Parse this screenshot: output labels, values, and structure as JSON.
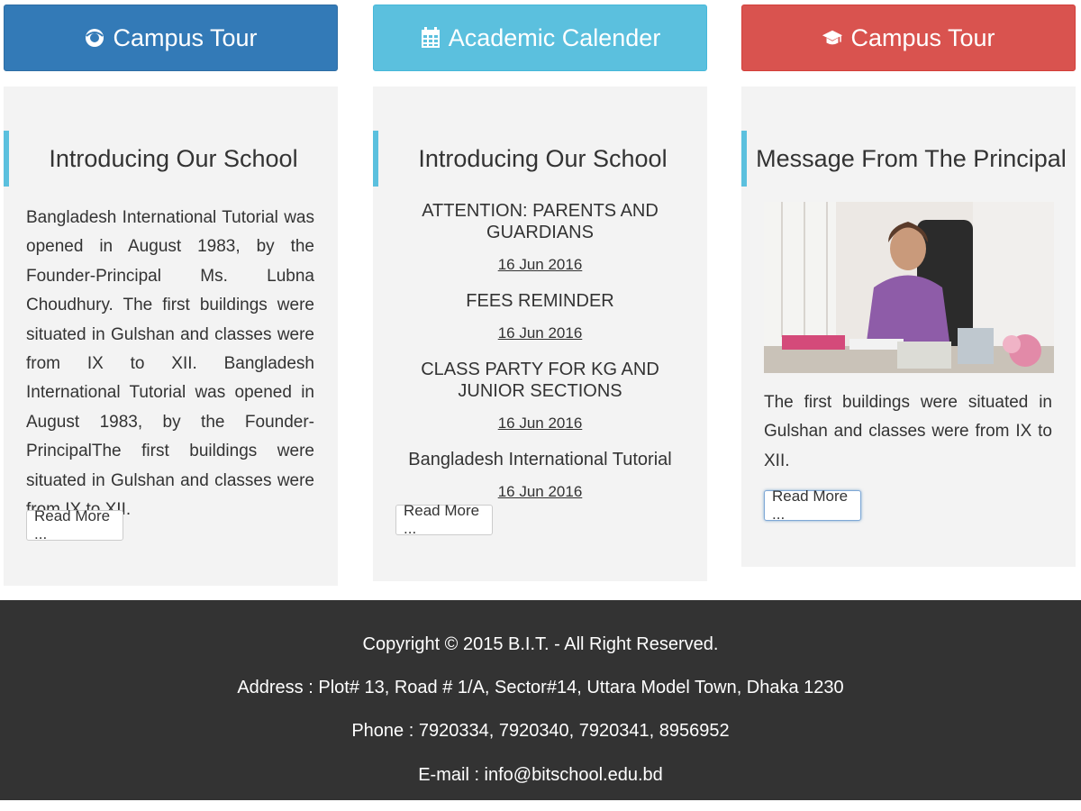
{
  "tabs": [
    {
      "label": "Campus Tour",
      "icon": "eye-icon",
      "color": "#337ab7"
    },
    {
      "label": "Academic Calender",
      "icon": "calendar-icon",
      "color": "#5bc0de"
    },
    {
      "label": "Campus Tour",
      "icon": "graduation-cap-icon",
      "color": "#d9534f"
    }
  ],
  "panels": [
    {
      "title": "Introducing Our School",
      "text": "Bangladesh International Tutorial was opened in August 1983, by the Founder-Principal Ms. Lubna Choudhury. The first buildings were situated in Gulshan and classes were from IX to XII. Bangladesh International Tutorial was opened in August 1983, by the Founder-PrincipalThe first buildings were situated in Gulshan and classes were from IX to XII.",
      "button": "Read More ..."
    },
    {
      "title": "Introducing Our School",
      "news": [
        {
          "title": "ATTENTION: PARENTS AND GUARDIANS",
          "date": "16 Jun 2016"
        },
        {
          "title": "FEES REMINDER",
          "date": "16 Jun 2016"
        },
        {
          "title": "CLASS PARTY FOR KG AND JUNIOR SECTIONS",
          "date": "16 Jun 2016"
        },
        {
          "title": "Bangladesh International Tutorial",
          "date": "16 Jun 2016"
        }
      ],
      "button": "Read More ..."
    },
    {
      "title": "Message From The Principal",
      "text": "The first buildings were situated in Gulshan and classes were from IX to XII.",
      "button": "Read More ..."
    }
  ],
  "footer": {
    "copyright": "Copyright © 2015 B.I.T. - All Right Reserved.",
    "address": "Address : Plot# 13, Road # 1/A, Sector#14, Uttara Model Town, Dhaka 1230",
    "phone": "Phone : 7920334, 7920340, 7920341, 8956952",
    "email": "E-mail : info@bitschool.edu.bd"
  }
}
